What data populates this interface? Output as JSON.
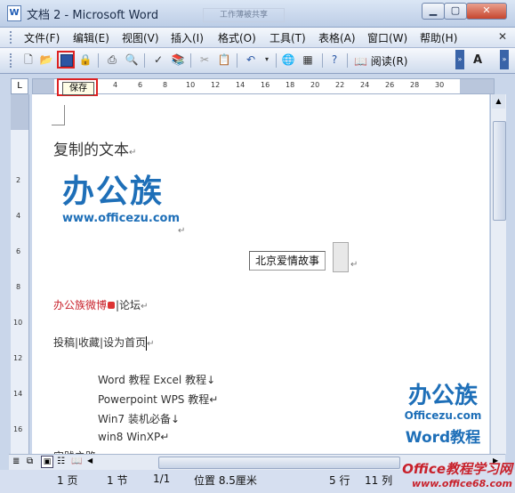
{
  "window": {
    "title": "文档 2 - Microsoft Word",
    "ghost_tab": "工作薄被共享"
  },
  "menu": [
    "文件(F)",
    "编辑(E)",
    "视图(V)",
    "插入(I)",
    "格式(O)",
    "工具(T)",
    "表格(A)",
    "窗口(W)",
    "帮助(H)"
  ],
  "toolbar": {
    "read_label": "阅读(R)",
    "font_btn": "A"
  },
  "tooltip": "保存",
  "ruler_numbers": [
    "4",
    "6",
    "8",
    "10",
    "12",
    "14",
    "16",
    "18",
    "20",
    "22",
    "24",
    "26",
    "28",
    "30"
  ],
  "vruler_numbers": [
    "2",
    "4",
    "6",
    "8",
    "10",
    "12",
    "14",
    "16"
  ],
  "document": {
    "heading": "复制的文本",
    "logo_text": "办公族",
    "logo_url": "www.officezu.com",
    "textbox": "北京爱情故事",
    "weibo_link": "办公族微博",
    "forum": "|论坛",
    "line2": "投稿|收藏|设为首页",
    "list": [
      "Word 教程  Excel 教程↓",
      "Powerpoint  WPS 教程↵",
      "Win7  装机必备↓",
      "win8  WinXP↵",
      "实践之路"
    ]
  },
  "watermark": {
    "line1": "办公族",
    "line2": "Officezu.com",
    "line3": "Word教程"
  },
  "status": {
    "page": "1 页",
    "section": "1 节",
    "pages": "1/1",
    "position": "位置 8.5厘米",
    "line": "5 行",
    "col": "11 列"
  },
  "site_watermark": {
    "text1": "Office教程学习网",
    "text2": "www.office68.com"
  },
  "colors": {
    "brand_blue": "#1e6fb8",
    "red": "#c8212b",
    "accent_frame": "#d22"
  }
}
